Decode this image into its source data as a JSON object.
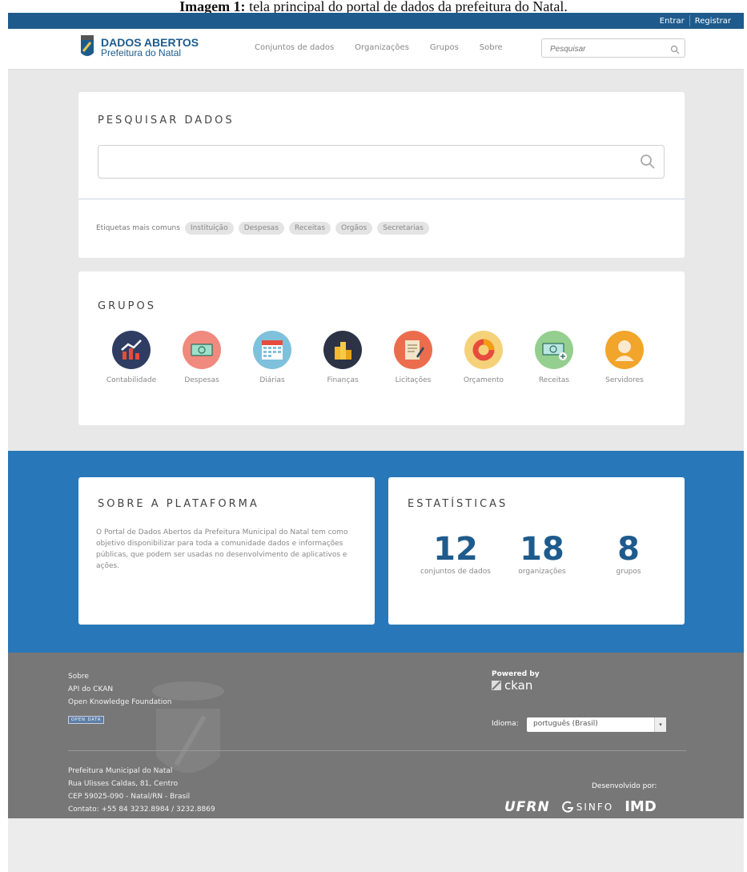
{
  "caption": {
    "prefix": "Imagem 1:",
    "text": "tela principal do portal de dados da prefeitura do Natal."
  },
  "topbar": {
    "login": "Entrar",
    "register": "Registrar"
  },
  "logo": {
    "title": "DADOS ABERTOS",
    "subtitle": "Prefeitura do Natal"
  },
  "nav": {
    "links": [
      "Conjuntos de dados",
      "Organizações",
      "Grupos",
      "Sobre"
    ],
    "search_placeholder": "Pesquisar"
  },
  "search_section": {
    "title": "PESQUISAR DADOS",
    "tags_label": "Etiquetas mais comuns",
    "tags": [
      "Instituição",
      "Despesas",
      "Receitas",
      "Orgãos",
      "Secretarias"
    ]
  },
  "groups_section": {
    "title": "GRUPOS",
    "items": [
      {
        "label": "Contabilidade",
        "icon": "chart-up-icon",
        "color": "#2f3d63"
      },
      {
        "label": "Despesas",
        "icon": "money-bill-icon",
        "color": "#f08a7e"
      },
      {
        "label": "Diárias",
        "icon": "calendar-icon",
        "color": "#7fc1dc"
      },
      {
        "label": "Finanças",
        "icon": "coins-icon",
        "color": "#2c3345"
      },
      {
        "label": "Licitações",
        "icon": "document-edit-icon",
        "color": "#ec6d4d"
      },
      {
        "label": "Orçamento",
        "icon": "donut-chart-icon",
        "color": "#f5d27a"
      },
      {
        "label": "Receitas",
        "icon": "money-plus-icon",
        "color": "#95cf8f"
      },
      {
        "label": "Servidores",
        "icon": "person-icon",
        "color": "#f1a52a"
      }
    ]
  },
  "about": {
    "title": "SOBRE A PLATAFORMA",
    "text": "O Portal de Dados Abertos da Prefeitura Municipal do Natal tem como objetivo disponibilizar para toda a comunidade dados e informações públicas, que podem ser usadas no desenvolvimento de aplicativos e ações."
  },
  "stats": {
    "title": "ESTATÍSTICAS",
    "items": [
      {
        "value": "12",
        "label": "conjuntos de dados"
      },
      {
        "value": "18",
        "label": "organizações"
      },
      {
        "value": "8",
        "label": "grupos"
      }
    ]
  },
  "footer": {
    "links": [
      "Sobre",
      "API do CKAN",
      "Open Knowledge Foundation"
    ],
    "open_data_badge": "OPEN DATA",
    "powered_by": "Powered by",
    "ckan": "ckan",
    "language_label": "Idioma:",
    "language_value": "português (Brasil)",
    "address": [
      "Prefeitura Municipal do Natal",
      "Rua Ulisses Caldas, 81, Centro",
      "CEP 59025-090 - Natal/RN - Brasil",
      "Contato: +55 84 3232.8984 / 3232.8869"
    ],
    "developed_by": "Desenvolvido por:",
    "partners": [
      "UFRN",
      "SINFO",
      "IMD"
    ]
  }
}
